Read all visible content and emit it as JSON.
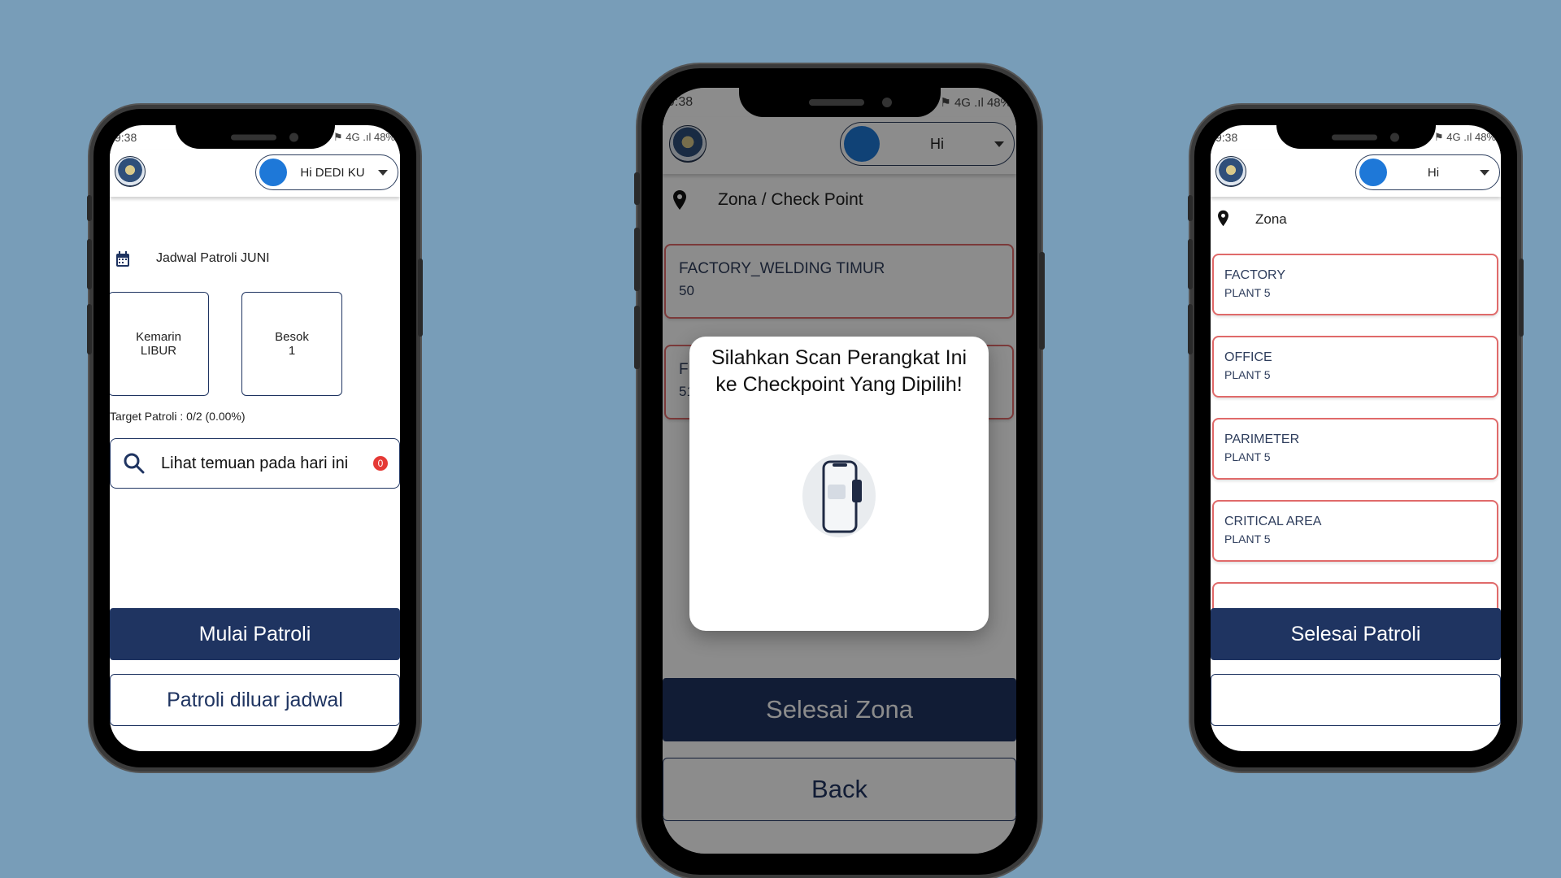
{
  "status": {
    "time": "9:38",
    "battery": "48%",
    "signal": "4G .ıl"
  },
  "left_screen": {
    "greeting": "Hi DEDI KU",
    "schedule_label": "Jadwal Patroli JUNI",
    "yesterday": {
      "title": "Kemarin",
      "value": "LIBUR"
    },
    "tomorrow": {
      "title": "Besok",
      "value": "1"
    },
    "target_text": "Target Patroli : 0/2 (0.00%)",
    "search_label": "Lihat temuan pada hari ini",
    "findings_count": "0",
    "start_button": "Mulai Patroli",
    "outside_button": "Patroli diluar jadwal"
  },
  "middle_screen": {
    "greeting": "Hi",
    "section_label": "Zona / Check Point",
    "checkpoints": [
      {
        "name": "FACTORY_WELDING TIMUR",
        "code": "50"
      },
      {
        "name": "F",
        "code": "51"
      }
    ],
    "modal": {
      "title": "Silahkan Scan Perangkat Ini ke Checkpoint Yang Dipilih!",
      "icon": "phone-nfc-scan-icon"
    },
    "finish_zone_button": "Selesai Zona",
    "back_button": "Back"
  },
  "right_screen": {
    "greeting": "Hi",
    "section_label": "Zona",
    "zones": [
      {
        "name": "FACTORY",
        "plant": "PLANT 5"
      },
      {
        "name": "OFFICE",
        "plant": "PLANT 5"
      },
      {
        "name": "PARIMETER",
        "plant": "PLANT 5"
      },
      {
        "name": "CRITICAL AREA",
        "plant": "PLANT 5"
      }
    ],
    "finish_button": "Selesai Patroli"
  },
  "colors": {
    "background": "#789db8",
    "primary": "#1f3461",
    "zone_border": "#e06a6a",
    "avatar": "#1e78d8",
    "badge": "#e53935"
  }
}
